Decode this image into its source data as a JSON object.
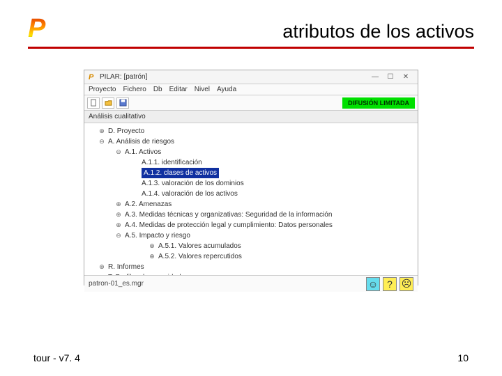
{
  "slide": {
    "title": "atributos de los activos",
    "footer_left": "tour - v7. 4",
    "footer_right": "10"
  },
  "window": {
    "title": "PILAR: [patrón]",
    "menubar": [
      "Proyecto",
      "Fichero",
      "Db",
      "Editar",
      "Nivel",
      "Ayuda"
    ],
    "diffusion": "DIFUSIÓN LIMITADA",
    "section": "Análisis cualitativo",
    "status_file": "patron-01_es.mgr"
  },
  "tree": {
    "d": "D. Proyecto",
    "a": "A. Análisis de riesgos",
    "a1": "A.1. Activos",
    "a11": "A.1.1. identificación",
    "a12": "A.1.2. clases de activos",
    "a13": "A.1.3. valoración de los dominios",
    "a14": "A.1.4. valoración de los activos",
    "a2": "A.2. Amenazas",
    "a3": "A.3. Medidas técnicas y organizativas: Seguridad de la información",
    "a4": "A.4. Medidas de protección legal y cumplimiento: Datos personales",
    "a5": "A.5. Impacto y riesgo",
    "a51": "A.5.1. Valores acumulados",
    "a52": "A.5.2. Valores repercutidos",
    "r": "R. Informes",
    "t": "T. Perfiles de seguridad"
  }
}
